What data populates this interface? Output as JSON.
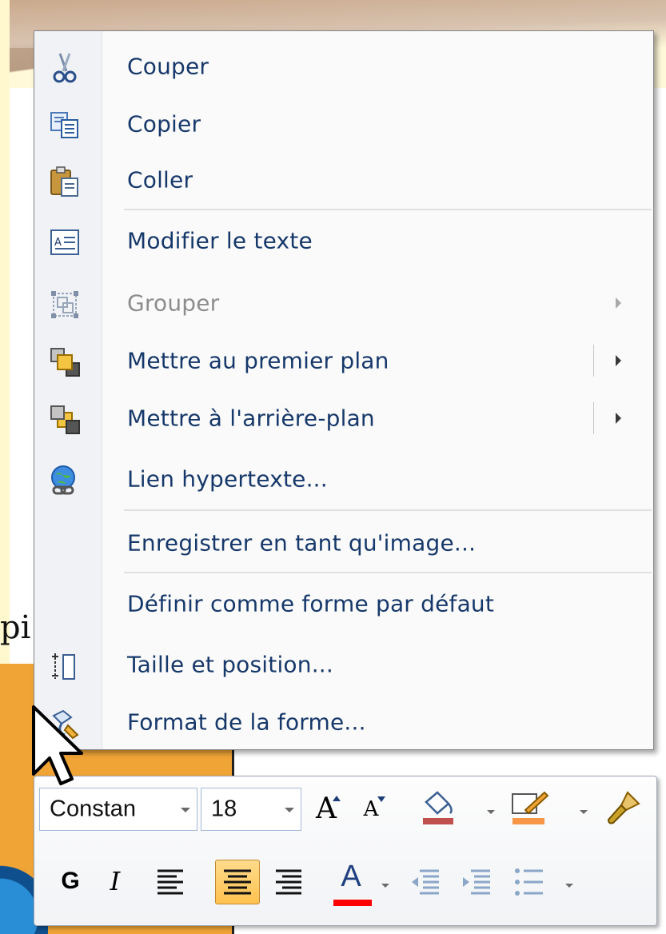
{
  "background": {
    "partial_text": "pi"
  },
  "context_menu": {
    "items": [
      {
        "id": "cut",
        "label": "Couper",
        "icon": "scissors-icon",
        "enabled": true,
        "submenu": false
      },
      {
        "id": "copy",
        "label": "Copier",
        "icon": "copy-icon",
        "enabled": true,
        "submenu": false
      },
      {
        "id": "paste",
        "label": "Coller",
        "icon": "paste-icon",
        "enabled": true,
        "submenu": false
      },
      {
        "id": "edit-text",
        "label": "Modifier le texte",
        "icon": "edit-text-icon",
        "enabled": true,
        "submenu": false
      },
      {
        "id": "group",
        "label": "Grouper",
        "icon": "group-icon",
        "enabled": false,
        "submenu": true
      },
      {
        "id": "bring-front",
        "label": "Mettre au premier plan",
        "icon": "bring-to-front-icon",
        "enabled": true,
        "submenu": true
      },
      {
        "id": "send-back",
        "label": "Mettre à l'arrière-plan",
        "icon": "send-to-back-icon",
        "enabled": true,
        "submenu": true
      },
      {
        "id": "hyperlink",
        "label": "Lien hypertexte...",
        "icon": "hyperlink-icon",
        "enabled": true,
        "submenu": false
      },
      {
        "id": "save-image",
        "label": "Enregistrer en tant qu'image...",
        "icon": "",
        "enabled": true,
        "submenu": false
      },
      {
        "id": "default-shape",
        "label": "Définir comme forme par défaut",
        "icon": "",
        "enabled": true,
        "submenu": false
      },
      {
        "id": "size-position",
        "label": "Taille et position...",
        "icon": "size-position-icon",
        "enabled": true,
        "submenu": false
      },
      {
        "id": "format-shape",
        "label": "Format de la forme...",
        "icon": "format-shape-icon",
        "enabled": true,
        "submenu": false
      }
    ]
  },
  "mini_toolbar": {
    "font_name": "Constan",
    "font_size": "18",
    "grow_font_label": "A",
    "shrink_font_label": "A",
    "bold_label": "G",
    "italic_label": "I",
    "font_color_label": "A",
    "fill_color": "#c0504d",
    "line_color": "#f79646",
    "font_color": "#ff0000"
  }
}
